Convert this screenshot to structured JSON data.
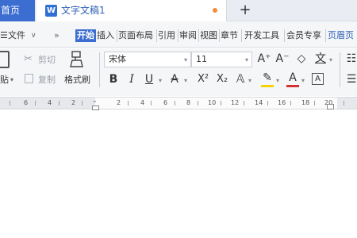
{
  "tabs": {
    "home_label": "首页",
    "doc_icon": "W",
    "doc_title": "文字文稿1",
    "new_tab": "+"
  },
  "menu": {
    "file_label": "文件",
    "more": "»",
    "items": [
      "开始",
      "插入",
      "页面布局",
      "引用",
      "审阅",
      "视图",
      "章节",
      "开发工具",
      "会员专享",
      "页眉页"
    ]
  },
  "toolbar": {
    "paste_label": "贴",
    "cut_label": "剪切",
    "copy_label": "复制",
    "format_painter_label": "格式刷",
    "font_name": "宋体",
    "font_size": "11",
    "bold": "B",
    "italic": "I",
    "underline": "U",
    "strike": "A",
    "superscript": "X²",
    "subscript": "X₂",
    "font_color": "A",
    "grow_font": "A⁺",
    "shrink_font": "A⁻",
    "phonetic": "文",
    "char_border": "A"
  },
  "ruler": {
    "left_labels": [
      "6",
      "4",
      "2"
    ],
    "right_labels": [
      "2",
      "4",
      "6",
      "8",
      "10",
      "12",
      "14",
      "16",
      "18",
      "20"
    ]
  },
  "colors": {
    "accent": "#3b6ed0",
    "modified_dot": "#f28c3a",
    "font_color_bar": "#d23232",
    "highlight_bar": "#f5d300"
  }
}
